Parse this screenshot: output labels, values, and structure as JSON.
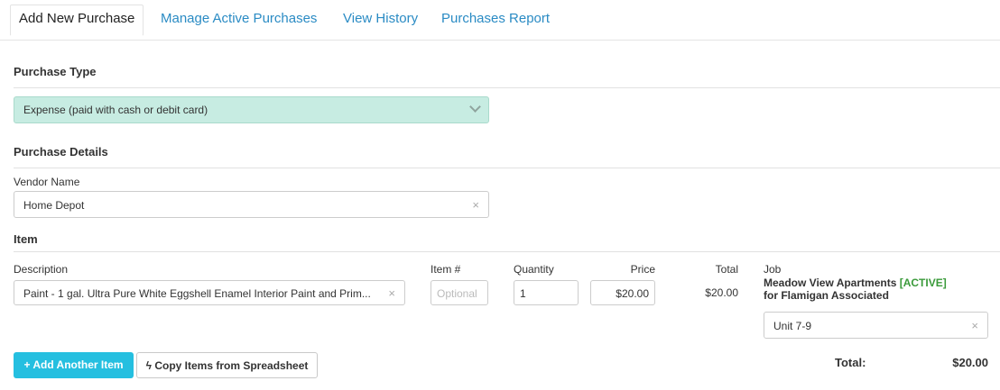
{
  "tabs": [
    {
      "label": "Add New Purchase"
    },
    {
      "label": "Manage Active Purchases"
    },
    {
      "label": "View History"
    },
    {
      "label": "Purchases Report"
    }
  ],
  "purchase_type": {
    "section_title": "Purchase Type",
    "selected": "Expense (paid with cash or debit card)"
  },
  "purchase_details": {
    "section_title": "Purchase Details",
    "vendor_label": "Vendor Name",
    "vendor_value": "Home Depot"
  },
  "item": {
    "section_title": "Item",
    "columns": {
      "description": "Description",
      "item_no": "Item #",
      "quantity": "Quantity",
      "price": "Price",
      "total": "Total",
      "job": "Job"
    },
    "row": {
      "description": "Paint - 1 gal. Ultra Pure White Eggshell Enamel Interior Paint and Prim...",
      "item_no_placeholder": "Optional",
      "quantity": "1",
      "price": "$20.00",
      "total": "$20.00",
      "job_name": "Meadow View Apartments",
      "job_status": "[ACTIVE]",
      "job_client": "for Flamigan Associated",
      "unit": "Unit 7-9"
    }
  },
  "actions": {
    "add_item": "+ Add Another Item",
    "copy_items": "Copy Items from Spreadsheet"
  },
  "summary": {
    "total_label": "Total:",
    "total_value": "$20.00"
  },
  "icons": {
    "clear": "×",
    "bolt": "ϟ"
  }
}
